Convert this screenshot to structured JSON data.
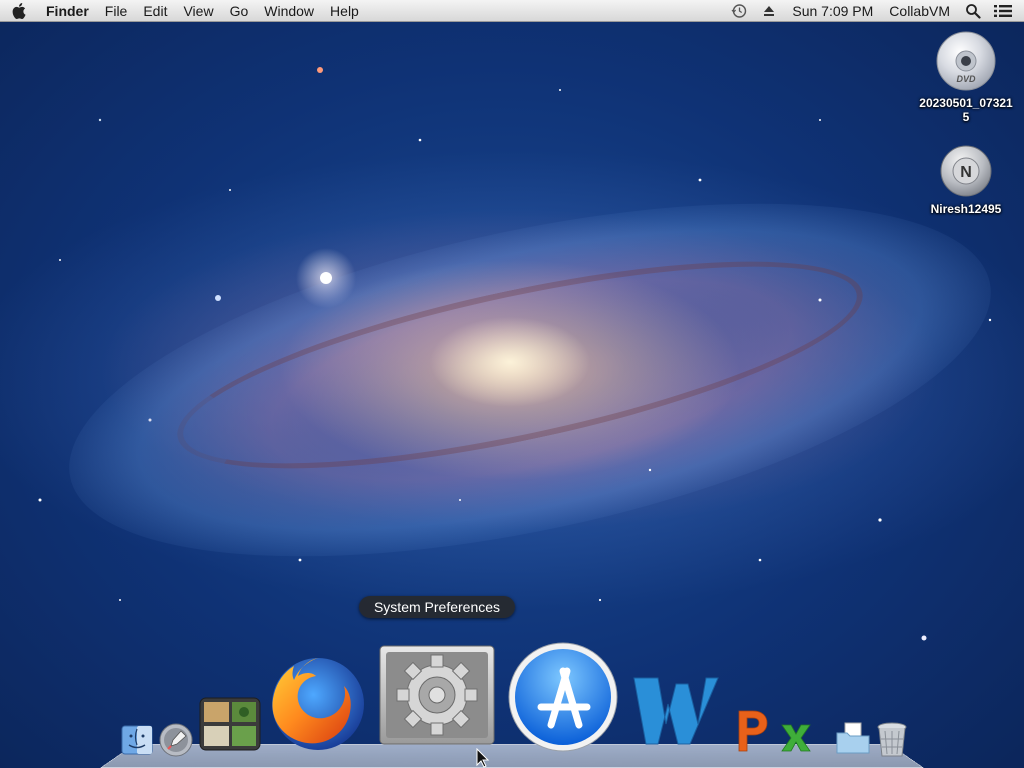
{
  "menubar": {
    "app_name": "Finder",
    "items": [
      "File",
      "Edit",
      "View",
      "Go",
      "Window",
      "Help"
    ],
    "clock": "Sun 7:09 PM",
    "user": "CollabVM",
    "icons": [
      "apple-icon",
      "time-machine-icon",
      "eject-icon",
      "spotlight-search-icon",
      "notification-list-icon"
    ]
  },
  "desktop": {
    "icons": [
      {
        "label": "20230501_073215",
        "icon": "dvd-icon"
      },
      {
        "label": "Niresh12495",
        "icon": "disk-icon"
      }
    ]
  },
  "dock": {
    "tooltip": "System Preferences",
    "items": [
      {
        "name": "Finder",
        "icon": "finder-icon"
      },
      {
        "name": "Launchpad",
        "icon": "launchpad-icon"
      },
      {
        "name": "Photo Booth",
        "icon": "photo-booth-icon"
      },
      {
        "name": "Firefox",
        "icon": "firefox-icon"
      },
      {
        "name": "System Preferences",
        "icon": "gear-icon"
      },
      {
        "name": "App Store",
        "icon": "app-store-icon"
      },
      {
        "name": "Microsoft Word",
        "icon": "word-icon"
      },
      {
        "name": "Microsoft PowerPoint",
        "icon": "powerpoint-icon"
      },
      {
        "name": "Microsoft Excel",
        "icon": "excel-icon"
      },
      {
        "name": "Documents",
        "icon": "documents-icon"
      },
      {
        "name": "Trash",
        "icon": "trash-icon"
      }
    ]
  },
  "colors": {
    "menubar_bg": "#e6e6e6",
    "wallpaper_blue": "#0f3275",
    "tooltip_bg": "#282828"
  }
}
